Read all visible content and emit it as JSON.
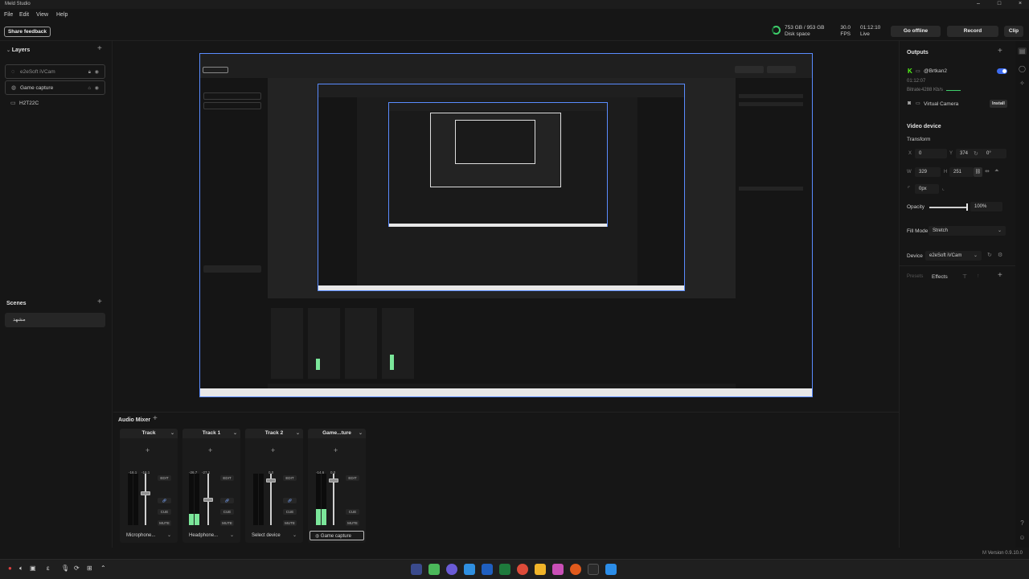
{
  "window": {
    "title": "Meld Studio"
  },
  "menu": [
    "File",
    "Edit",
    "View",
    "Help"
  ],
  "toolbar": {
    "share_feedback": "Share feedback",
    "disk_value": "753 GB / 953 GB",
    "disk_label": "Disk space",
    "fps_value": "30.0",
    "fps_label": "FPS",
    "live_time": "01:12:10",
    "live_label": "Live",
    "go_offline": "Go offline",
    "record": "Record",
    "clip": "Clip"
  },
  "layers": {
    "title": "Layers",
    "items": [
      {
        "label": "e2eSoft iVCam"
      },
      {
        "label": "Game capture"
      },
      {
        "label": "H2T22C"
      }
    ]
  },
  "scenes": {
    "title": "Scenes",
    "items": [
      {
        "label": "مشهد"
      }
    ]
  },
  "mixer": {
    "title": "Audio Mixer",
    "tracks": [
      {
        "name": "Track",
        "db_left": "-16.1",
        "db_right": "-16.1",
        "device": "Microphone...",
        "level": 0.0
      },
      {
        "name": "Track 1",
        "db_left": "-26.7",
        "db_right": "-27.1",
        "device": "Headphone...",
        "level": 0.22
      },
      {
        "name": "Track 2",
        "db_left": "",
        "db_right": "0.0",
        "device": "Select device",
        "level": 0.0
      },
      {
        "name": "Game...ture",
        "db_left": "-14.6",
        "db_right": "0.0",
        "device": "Game capture",
        "level": 0.32
      }
    ],
    "edit": "EDIT",
    "cue": "CUE",
    "mute": "MUTE"
  },
  "outputs": {
    "title": "Outputs",
    "account": "@Brtkan2",
    "time": "01:12:07",
    "bitrate_label": "Bitrate",
    "bitrate_value": "4288 Kb/s",
    "virtual_camera": "Virtual Camera",
    "install": "Install"
  },
  "video_device": {
    "title": "Video device",
    "transform": "Transform",
    "x_label": "X",
    "x": "0",
    "y_label": "Y",
    "y": "374",
    "rotation": "0°",
    "w_label": "W",
    "w": "329",
    "h_label": "H",
    "h": "251",
    "corner": "0px",
    "opacity_label": "Opacity",
    "opacity": "100%",
    "fill_mode_label": "Fill Mode",
    "fill_mode": "Stretch",
    "device_label": "Device",
    "device": "e2eSoft iVCam",
    "presets": "Presets",
    "effects": "Effects"
  },
  "status": {
    "version": "Version 0.9.10.0"
  },
  "colors": {
    "accent": "#5a8cff",
    "live_green": "#3ecf6b",
    "meter_green": "#7be69a"
  }
}
